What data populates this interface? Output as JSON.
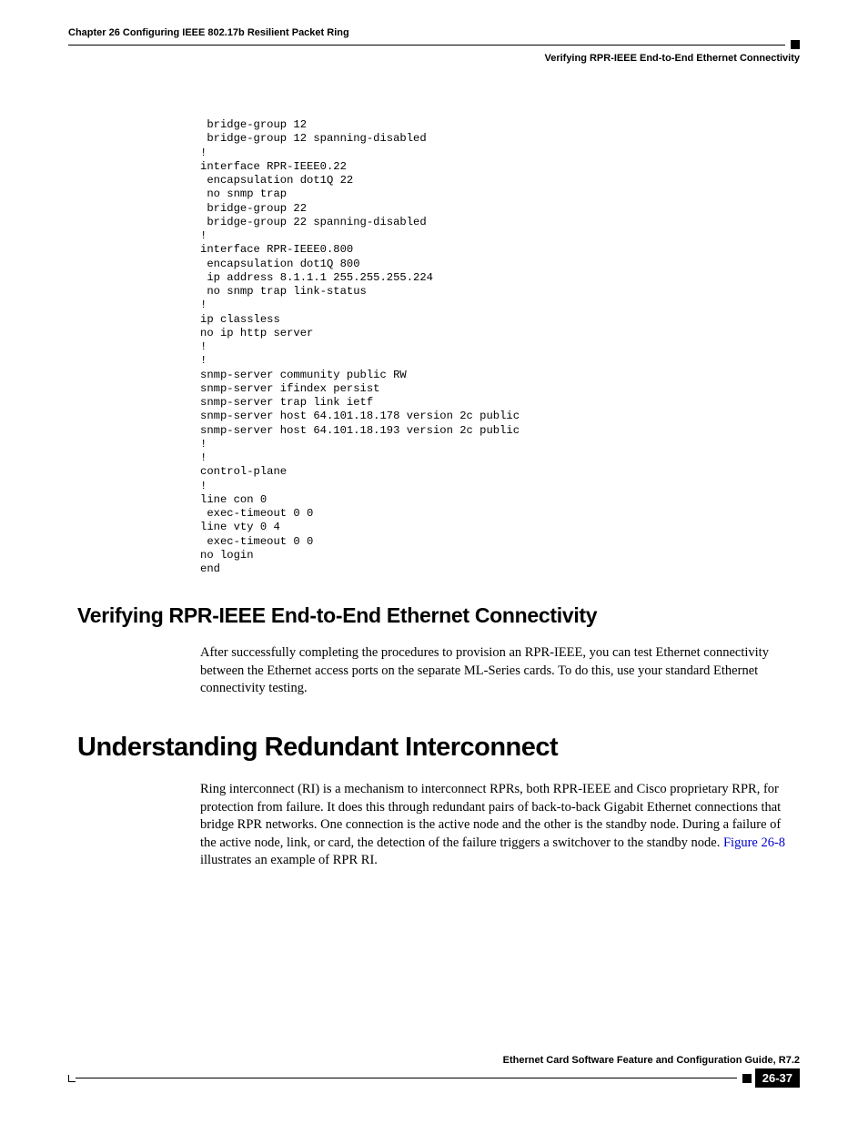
{
  "header": {
    "chapter": "Chapter 26 Configuring IEEE 802.17b Resilient Packet Ring",
    "section": "Verifying RPR-IEEE End-to-End Ethernet Connectivity"
  },
  "code": " bridge-group 12\n bridge-group 12 spanning-disabled\n!\ninterface RPR-IEEE0.22\n encapsulation dot1Q 22\n no snmp trap\n bridge-group 22\n bridge-group 22 spanning-disabled\n!\ninterface RPR-IEEE0.800\n encapsulation dot1Q 800\n ip address 8.1.1.1 255.255.255.224\n no snmp trap link-status\n!\nip classless\nno ip http server\n!\n!\nsnmp-server community public RW\nsnmp-server ifindex persist\nsnmp-server trap link ietf\nsnmp-server host 64.101.18.178 version 2c public\nsnmp-server host 64.101.18.193 version 2c public\n!\n!\ncontrol-plane\n!\nline con 0\n exec-timeout 0 0\nline vty 0 4\n exec-timeout 0 0\nno login\nend",
  "sections": {
    "verify": {
      "heading": "Verifying RPR-IEEE End-to-End Ethernet Connectivity",
      "paragraph": "After successfully completing the procedures to provision an RPR-IEEE, you can test Ethernet connectivity between the Ethernet access ports on the separate ML-Series cards. To do this, use your standard Ethernet connectivity testing."
    },
    "understand": {
      "heading": "Understanding Redundant Interconnect",
      "para_part1": "Ring interconnect (RI) is a mechanism to interconnect RPRs, both RPR-IEEE and Cisco proprietary RPR, for protection from failure. It does this through redundant pairs of back-to-back Gigabit Ethernet connections that bridge RPR networks. One connection is the active node and the other is the standby node. During a failure of the active node, link, or card, the detection of the failure triggers a switchover to the standby node. ",
      "figure_link": "Figure 26-8",
      "para_part2": " illustrates an example of RPR RI."
    }
  },
  "footer": {
    "title": "Ethernet Card Software Feature and Configuration Guide, R7.2",
    "page": "26-37"
  }
}
